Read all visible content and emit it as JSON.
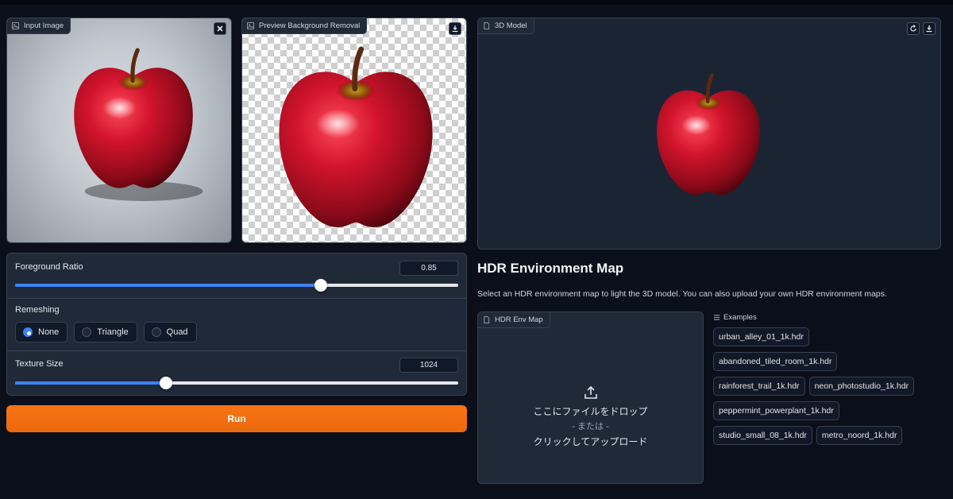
{
  "input_panel": {
    "label": "Input Image",
    "close_icon": "close-icon"
  },
  "preview_panel": {
    "label": "Preview Background Removal",
    "download_icon": "download-icon"
  },
  "model_panel": {
    "label": "3D Model",
    "reset_icon": "rotate-icon",
    "download_icon": "download-icon"
  },
  "controls": {
    "foreground_ratio": {
      "label": "Foreground Ratio",
      "value": "0.85",
      "fraction": 0.69
    },
    "remeshing": {
      "label": "Remeshing",
      "options": [
        "None",
        "Triangle",
        "Quad"
      ],
      "selected": "None"
    },
    "texture_size": {
      "label": "Texture Size",
      "value": "1024",
      "fraction": 0.34
    }
  },
  "run_button": {
    "label": "Run"
  },
  "hdr": {
    "title": "HDR Environment Map",
    "description": "Select an HDR environment map to light the 3D model. You can also upload your own HDR environment maps.",
    "upload_label": "HDR Env Map",
    "drop_text": "ここにファイルをドロップ",
    "or_text": "- または -",
    "click_text": "クリックしてアップロード"
  },
  "examples": {
    "label": "Examples",
    "rows": [
      [
        "urban_alley_01_1k.hdr"
      ],
      [
        "abandoned_tiled_room_1k.hdr"
      ],
      [
        "rainforest_trail_1k.hdr",
        "neon_photostudio_1k.hdr"
      ],
      [
        "peppermint_powerplant_1k.hdr"
      ],
      [
        "studio_small_08_1k.hdr",
        "metro_noord_1k.hdr"
      ]
    ]
  },
  "colors": {
    "background": "#0b0f19",
    "panel": "#1f2937",
    "accent": "#3b82f6",
    "run": "#f97316",
    "apple": "#c8102e"
  }
}
